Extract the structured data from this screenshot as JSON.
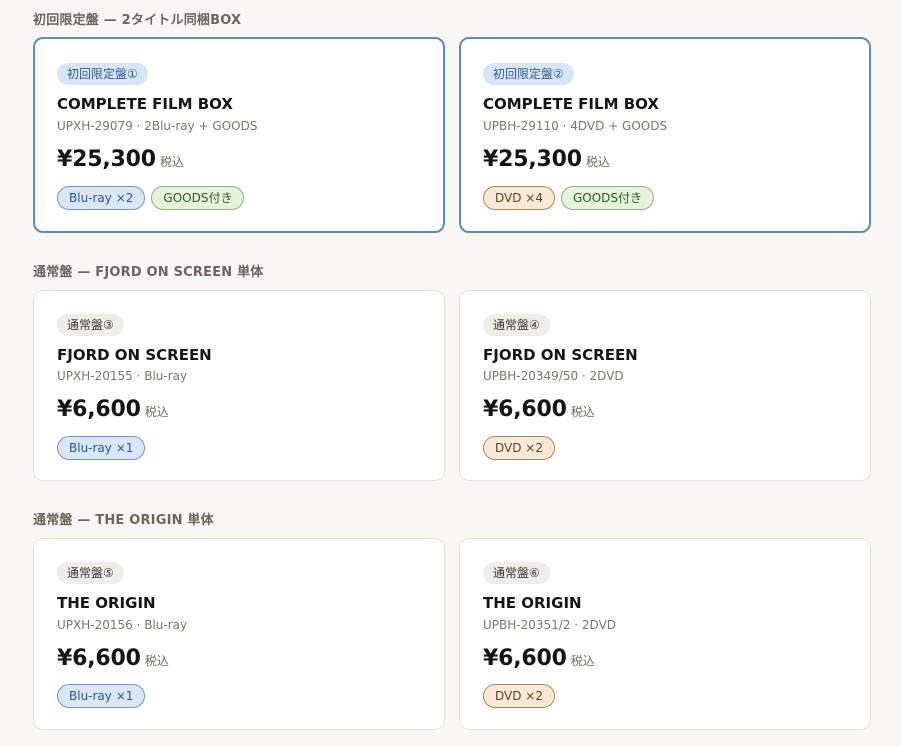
{
  "sections": [
    {
      "heading": "初回限定盤 — 2タイトル同梱BOX",
      "cards": [
        {
          "badge": "初回限定盤①",
          "title": "COMPLETE FILM BOX",
          "catalog": "UPXH-29079 · 2Blu-ray + GOODS",
          "price": "¥25,300",
          "tax": "税込",
          "tags": [
            "Blu-ray ×2",
            "GOODS付き"
          ]
        },
        {
          "badge": "初回限定盤②",
          "title": "COMPLETE FILM BOX",
          "catalog": "UPBH-29110 · 4DVD + GOODS",
          "price": "¥25,300",
          "tax": "税込",
          "tags": [
            "DVD ×4",
            "GOODS付き"
          ]
        }
      ]
    },
    {
      "heading": "通常盤 — FJORD ON SCREEN 単体",
      "cards": [
        {
          "badge": "通常盤③",
          "title": "FJORD ON SCREEN",
          "catalog": "UPXH-20155 · Blu-ray",
          "price": "¥6,600",
          "tax": "税込",
          "tags": [
            "Blu-ray ×1"
          ]
        },
        {
          "badge": "通常盤④",
          "title": "FJORD ON SCREEN",
          "catalog": "UPBH-20349/50 · 2DVD",
          "price": "¥6,600",
          "tax": "税込",
          "tags": [
            "DVD ×2"
          ]
        }
      ]
    },
    {
      "heading": "通常盤 — THE ORIGIN 単体",
      "cards": [
        {
          "badge": "通常盤⑤",
          "title": "THE ORIGIN",
          "catalog": "UPXH-20156 · Blu-ray",
          "price": "¥6,600",
          "tax": "税込",
          "tags": [
            "Blu-ray ×1"
          ]
        },
        {
          "badge": "通常盤⑥",
          "title": "THE ORIGIN",
          "catalog": "UPBH-20351/2 · 2DVD",
          "price": "¥6,600",
          "tax": "税込",
          "tags": [
            "DVD ×2"
          ]
        }
      ]
    }
  ],
  "colors": {
    "limited_border": "#5b8cc0",
    "bluray_tag": "#d9e7f8",
    "dvd_tag": "#f8ead6",
    "goods_tag": "#e5f3dc"
  }
}
